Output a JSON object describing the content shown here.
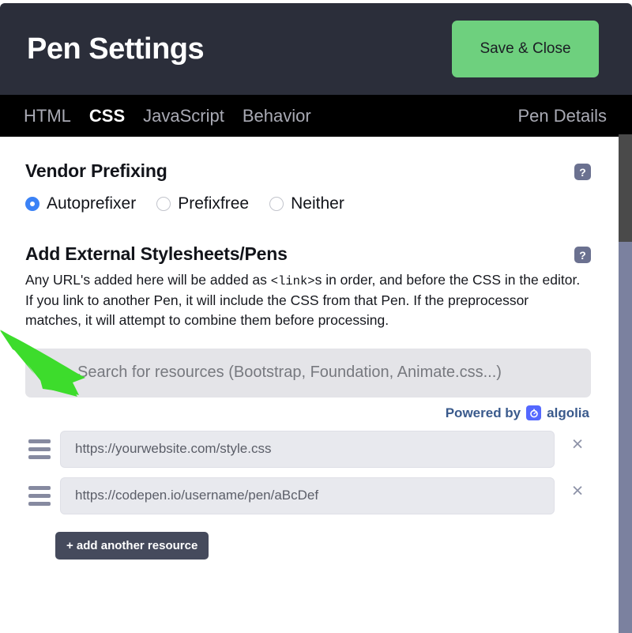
{
  "header": {
    "title": "Pen Settings",
    "save_label": "Save & Close"
  },
  "nav": {
    "tabs": [
      {
        "label": "HTML",
        "active": false
      },
      {
        "label": "CSS",
        "active": true
      },
      {
        "label": "JavaScript",
        "active": false
      },
      {
        "label": "Behavior",
        "active": false
      }
    ],
    "right_tab": "Pen Details"
  },
  "vendor_prefixing": {
    "title": "Vendor Prefixing",
    "help": "?",
    "options": [
      {
        "label": "Autoprefixer",
        "selected": true
      },
      {
        "label": "Prefixfree",
        "selected": false
      },
      {
        "label": "Neither",
        "selected": false
      }
    ]
  },
  "external": {
    "title": "Add External Stylesheets/Pens",
    "help": "?",
    "description_part1": "Any URL's added here will be added as ",
    "description_code": "<link>",
    "description_part2": "s in order, and before the CSS in the editor. If you link to another Pen, it will include the CSS from that Pen. If the preprocessor matches, it will attempt to combine them before processing.",
    "search": {
      "placeholder": "Search for resources (Bootstrap, Foundation, Animate.css...)",
      "value": "",
      "icon": "search-icon"
    },
    "algolia": {
      "powered_by": "Powered by",
      "brand": "algolia"
    },
    "resources": [
      {
        "value": "https://yourwebsite.com/style.css",
        "remove_label": "×"
      },
      {
        "value": "https://codepen.io/username/pen/aBcDef",
        "remove_label": "×"
      }
    ],
    "add_button": "+ add another resource"
  },
  "colors": {
    "header_bg": "#2b2e3a",
    "nav_bg": "#000000",
    "accent_green": "#6ed07e",
    "radio_blue": "#3b82f6",
    "help_badge": "#6b7190",
    "algolia_blue": "#5468ff",
    "arrow_green": "#3ddc2c",
    "scrollbar_track": "#7b819f",
    "scrollbar_thumb": "#4a4a4a"
  }
}
